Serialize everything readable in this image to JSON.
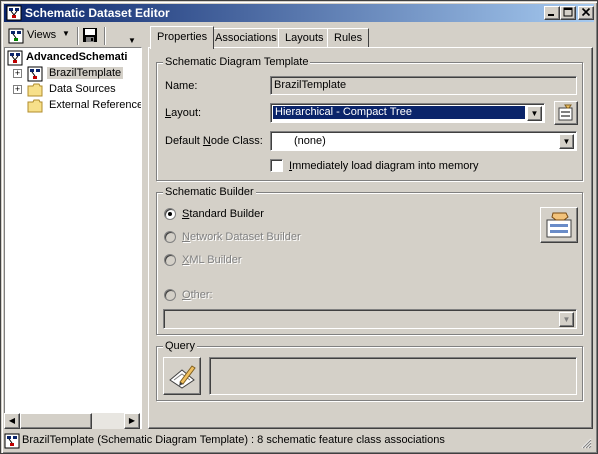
{
  "window": {
    "title": "Schematic Dataset Editor",
    "minimize_glyph": "0",
    "maximize_glyph": "1",
    "close_glyph": "r"
  },
  "toolbar": {
    "views_label": "Views"
  },
  "tree": {
    "root": "AdvancedSchemati",
    "items": [
      {
        "label": "BrazilTemplate",
        "selected": true,
        "expandable": true
      },
      {
        "label": "Data Sources",
        "expandable": true
      },
      {
        "label": "External Reference",
        "expandable": false
      }
    ]
  },
  "tabs": [
    {
      "label": "Properties",
      "active": true
    },
    {
      "label": "Associations"
    },
    {
      "label": "Layouts"
    },
    {
      "label": "Rules"
    }
  ],
  "template_group": {
    "title": "Schematic Diagram Template",
    "name_label": "Name:",
    "name_value": "BrazilTemplate",
    "layout_label": "Layout:",
    "layout_value": "Hierarchical - Compact Tree",
    "default_node_label": "Default Node Class:",
    "default_node_value": "(none)",
    "load_memory_label": "Immediately load diagram into memory",
    "load_memory_checked": false
  },
  "builder_group": {
    "title": "Schematic Builder",
    "options": [
      {
        "label": "Standard Builder",
        "checked": true,
        "enabled": true
      },
      {
        "label": "Network Dataset Builder",
        "checked": false,
        "enabled": false
      },
      {
        "label": "XML Builder",
        "checked": false,
        "enabled": false
      },
      {
        "label": "Other:",
        "checked": false,
        "enabled": false
      }
    ],
    "other_value": ""
  },
  "query_group": {
    "title": "Query",
    "query_text": ""
  },
  "status": {
    "text": "BrazilTemplate (Schematic Diagram Template) : 8 schematic feature class associations"
  },
  "colors": {
    "title_start": "#0a246a",
    "title_end": "#a6caf0",
    "face": "#d4d0c8",
    "selection": "#0a246a"
  }
}
